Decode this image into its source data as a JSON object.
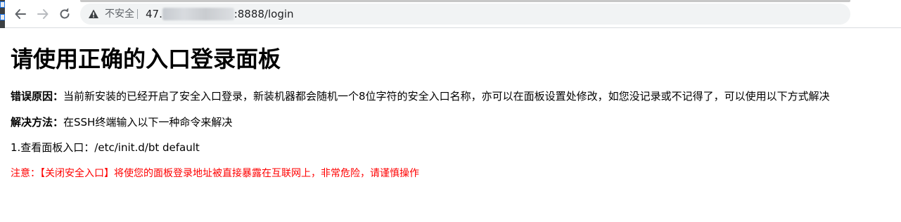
{
  "browser": {
    "security_label": "不安全",
    "url_prefix": "47.",
    "url_hidden": "███ ███ ██",
    "url_suffix": ":8888/login",
    "icons": [
      "back-icon",
      "forward-icon",
      "reload-icon",
      "warning-icon"
    ]
  },
  "page": {
    "title": "请使用正确的入口登录面板",
    "error_reason_label": "错误原因：",
    "error_reason_text": "当前新安装的已经开启了安全入口登录，新装机器都会随机一个8位字符的安全入口名称，亦可以在面板设置处修改，如您没记录或不记得了，可以使用以下方式解决",
    "solution_label": "解决方法：",
    "solution_text": "在SSH终端输入以下一种命令来解决",
    "command_line": "1.查看面板入口：/etc/init.d/bt default",
    "warning_text": "注意：【关闭安全入口】将使您的面板登录地址被直接暴露在互联网上，非常危险，请谨慎操作",
    "warning_color": "#ff0000"
  }
}
